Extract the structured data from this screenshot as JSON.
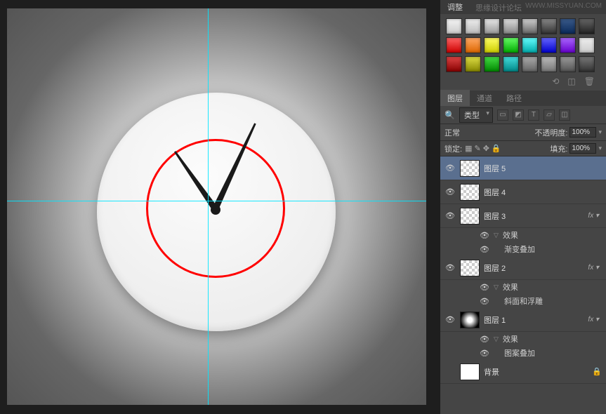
{
  "watermark": "思缘设计论坛",
  "watermark_url": "WWW.MISSYUAN.COM",
  "top_tab": "调整",
  "swatch_icons": {
    "reset": "⟲",
    "new": "◫",
    "trash": "🗑"
  },
  "layer_panel": {
    "tabs": [
      "图层",
      "通道",
      "路径"
    ],
    "filter_label": "类型",
    "filter_icons": [
      "▭",
      "◩",
      "T",
      "▱",
      "◫"
    ],
    "blend_mode": "正常",
    "opacity_label": "不透明度:",
    "opacity_value": "100%",
    "lock_label": "锁定:",
    "fill_label": "填充:",
    "fill_value": "100%",
    "lock_icons": [
      "▦",
      "✎",
      "✥",
      "🔒"
    ]
  },
  "layers": [
    {
      "name": "图层 5",
      "thumb": "checker",
      "selected": true,
      "effects": []
    },
    {
      "name": "图层 4",
      "thumb": "checker",
      "effects": []
    },
    {
      "name": "图层 3",
      "thumb": "checker",
      "fx": true,
      "effects": [
        "效果",
        "渐变叠加"
      ]
    },
    {
      "name": "图层 2",
      "thumb": "checker",
      "fx": true,
      "effects": [
        "效果",
        "斜面和浮雕"
      ]
    },
    {
      "name": "图层 1",
      "thumb": "radial",
      "fx": true,
      "effects": [
        "效果",
        "图案叠加"
      ]
    },
    {
      "name": "背景",
      "thumb": "white",
      "locked": true,
      "no_eye": true,
      "effects": []
    }
  ]
}
